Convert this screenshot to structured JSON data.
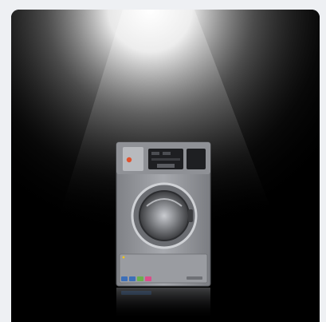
{
  "scene": {
    "subject": "washer-extractor",
    "background_color": "#000000",
    "page_color": "#eef0f3",
    "machine_color": "#9a9ca1",
    "accent_colors": [
      "#3d6fb8",
      "#6ab04c",
      "#d94f8a",
      "#f0c419"
    ],
    "control_panel": {
      "button_color": "#e0522e"
    }
  }
}
